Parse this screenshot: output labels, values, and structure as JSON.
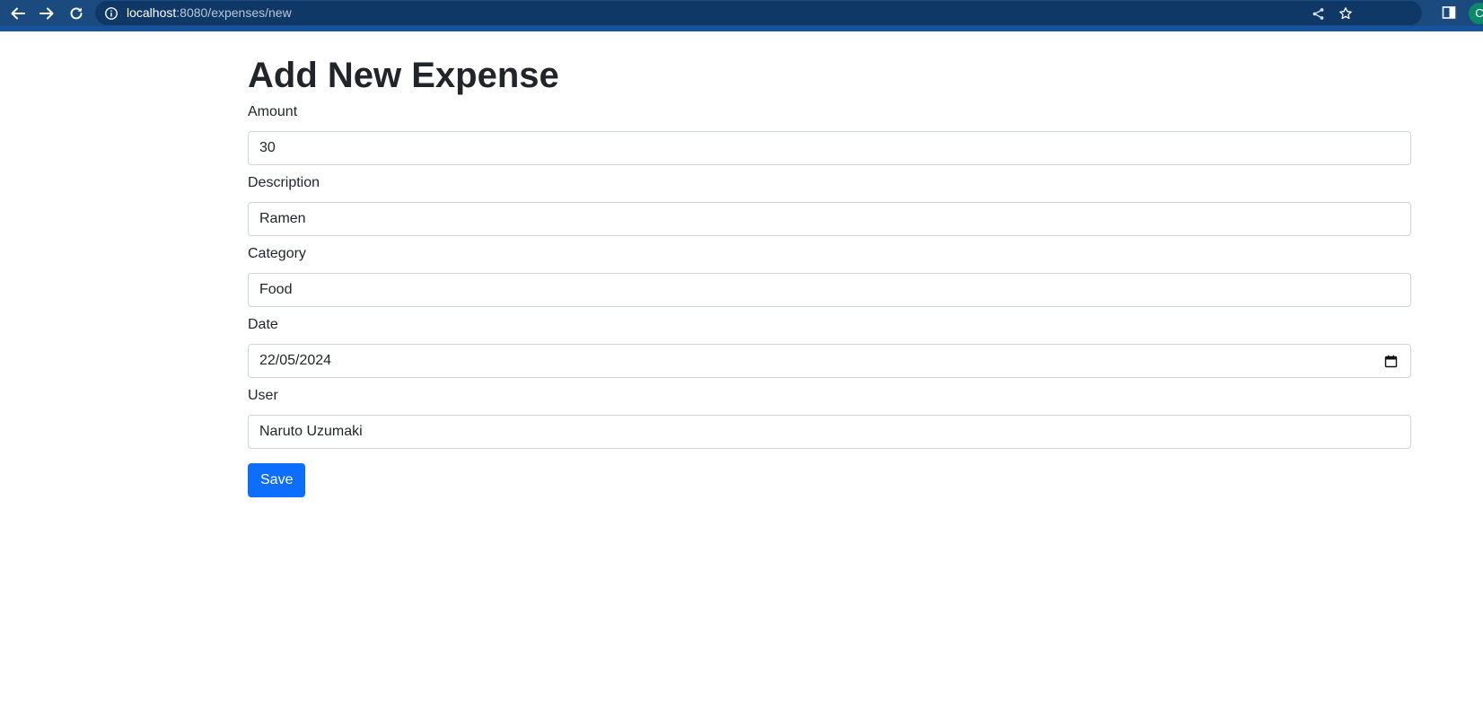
{
  "browser": {
    "url_host": "localhost",
    "url_path": ":8080/expenses/new",
    "profile_initial": "C",
    "icons": {
      "back": "arrow-left-icon",
      "forward": "arrow-right-icon",
      "reload": "reload-icon",
      "site_info": "info-icon",
      "share": "share-icon",
      "bookmark": "star-icon",
      "side_panel": "side-panel-icon"
    }
  },
  "page": {
    "title": "Add New Expense",
    "fields": {
      "amount": {
        "label": "Amount",
        "value": "30"
      },
      "description": {
        "label": "Description",
        "value": "Ramen"
      },
      "category": {
        "label": "Category",
        "value": "Food"
      },
      "date": {
        "label": "Date",
        "value": "22/05/2024"
      },
      "user": {
        "label": "User",
        "value": "Naruto Uzumaki"
      }
    },
    "save_label": "Save"
  },
  "colors": {
    "toolbar": "#1b4a7e",
    "primary_button": "#0d6efd",
    "input_border": "#ced4da",
    "text": "#212529"
  }
}
